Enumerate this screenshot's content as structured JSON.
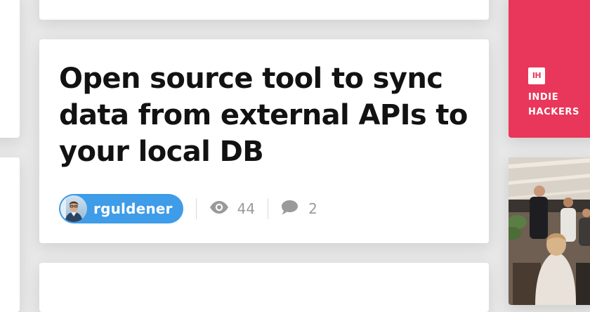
{
  "post": {
    "title": "Open source tool to sync data from external APIs to your local DB",
    "author": "rguldener",
    "views": "44",
    "comments": "2"
  },
  "sidebar_ad": {
    "logo_text": "IH",
    "line1": "INDIE",
    "line2": "HACKERS"
  },
  "colors": {
    "author_pill": "#3e9ce8",
    "indie_hackers_brand": "#e8375a",
    "meta_gray": "#9a9a9a"
  },
  "icons": {
    "views": "eye-icon",
    "comments": "speech-bubble-icon"
  }
}
